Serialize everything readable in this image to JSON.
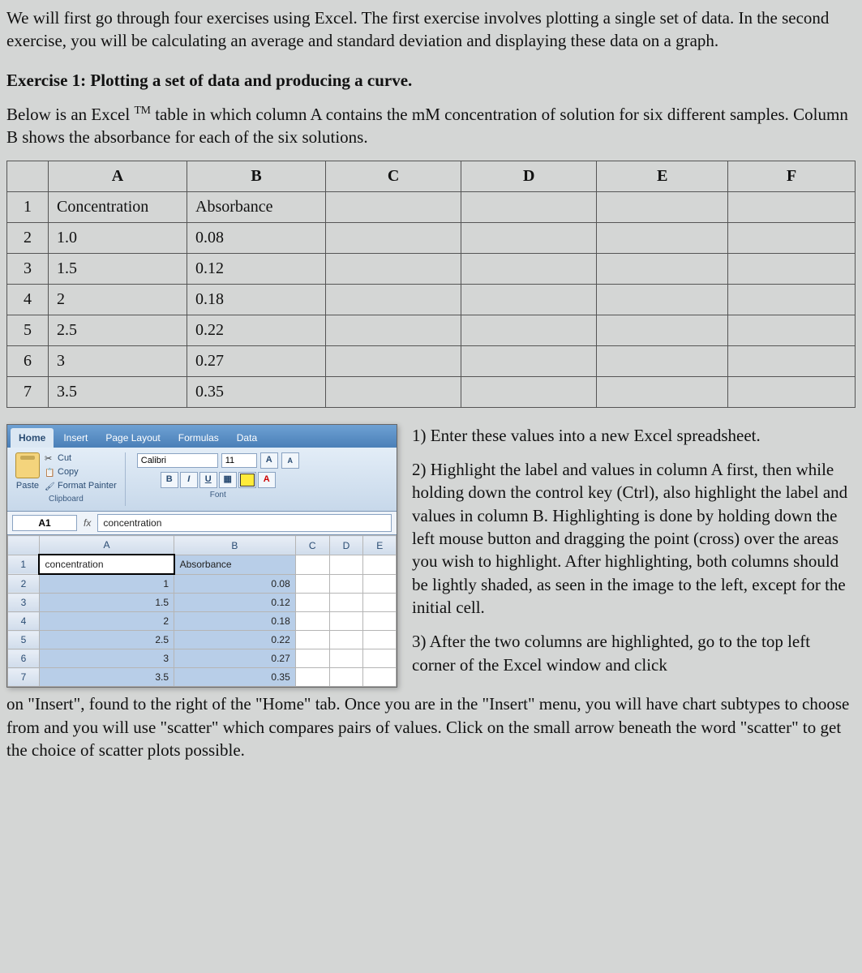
{
  "intro_para": "We will first go through four exercises using Excel. The first exercise involves plotting a single set of data. In the second exercise, you will be calculating an average and standard deviation and displaying these data on a graph.",
  "exercise_title": "Exercise 1: Plotting a set of data and producing a curve.",
  "exercise_intro_a": "Below is an Excel ",
  "exercise_tm": "TM",
  "exercise_intro_b": " table in which column A contains the mM concentration of solution for six different samples.  Column B shows the absorbance for each of the six solutions.",
  "table": {
    "cols": [
      "A",
      "B",
      "C",
      "D",
      "E",
      "F"
    ],
    "rows": [
      {
        "n": "1",
        "a": "Concentration",
        "b": "Absorbance"
      },
      {
        "n": "2",
        "a": "1.0",
        "b": "0.08"
      },
      {
        "n": "3",
        "a": "1.5",
        "b": "0.12"
      },
      {
        "n": "4",
        "a": "2",
        "b": "0.18"
      },
      {
        "n": "5",
        "a": "2.5",
        "b": "0.22"
      },
      {
        "n": "6",
        "a": "3",
        "b": "0.27"
      },
      {
        "n": "7",
        "a": "3.5",
        "b": "0.35"
      }
    ]
  },
  "ribbon": {
    "tabs": [
      "Home",
      "Insert",
      "Page Layout",
      "Formulas",
      "Data"
    ],
    "active_tab": "Home",
    "clipboard": {
      "paste": "Paste",
      "cut": "Cut",
      "copy": "Copy",
      "format_painter": "Format Painter",
      "group": "Clipboard"
    },
    "font": {
      "name": "Calibri",
      "size": "11",
      "group": "Font"
    },
    "namebox": "A1",
    "fx": "fx",
    "formula_value": "concentration"
  },
  "sheet": {
    "cols": [
      "",
      "A",
      "B",
      "C",
      "D",
      "E"
    ],
    "rows": [
      {
        "n": "1",
        "a": "concentration",
        "b": "Absorbance",
        "c": "",
        "d": "",
        "e": ""
      },
      {
        "n": "2",
        "a": "1",
        "b": "0.08",
        "c": "",
        "d": "",
        "e": ""
      },
      {
        "n": "3",
        "a": "1.5",
        "b": "0.12",
        "c": "",
        "d": "",
        "e": ""
      },
      {
        "n": "4",
        "a": "2",
        "b": "0.18",
        "c": "",
        "d": "",
        "e": ""
      },
      {
        "n": "5",
        "a": "2.5",
        "b": "0.22",
        "c": "",
        "d": "",
        "e": ""
      },
      {
        "n": "6",
        "a": "3",
        "b": "0.27",
        "c": "",
        "d": "",
        "e": ""
      },
      {
        "n": "7",
        "a": "3.5",
        "b": "0.35",
        "c": "",
        "d": "",
        "e": ""
      }
    ]
  },
  "steps": {
    "s1": "1) Enter these values into a new Excel spreadsheet.",
    "s2": "2) Highlight the label and values in column A first, then while holding down the control key (Ctrl), also highlight the label and values in column B.  Highlighting is done by holding down the left mouse button and dragging the point (cross) over the areas you wish to highlight.  After highlighting, both columns should be lightly shaded, as seen in the image to the left, except for the initial cell.",
    "s3": "3) After the two columns are highlighted, go to the top left corner of the Excel window and click"
  },
  "continuation": "on \"Insert\", found to the right of the \"Home\" tab.  Once you are in the \"Insert\" menu, you will have chart subtypes to choose from and you will use \"scatter\" which compares pairs of values.  Click on the small arrow beneath the word \"scatter\" to get the choice of scatter plots possible."
}
